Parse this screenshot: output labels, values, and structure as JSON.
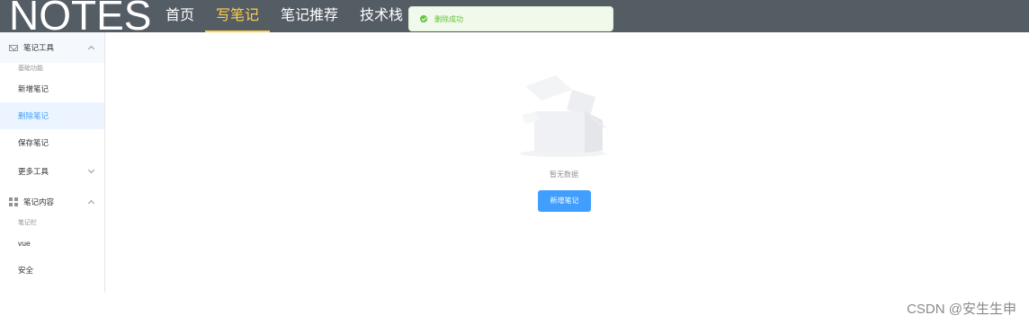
{
  "header": {
    "logo": "NOTES",
    "nav": [
      "首页",
      "写笔记",
      "笔记推荐",
      "技术栈"
    ]
  },
  "toast": {
    "message": "删除成功",
    "icon": "success-check-icon",
    "color": "#67c23a"
  },
  "sidebar": {
    "section1": {
      "title": "笔记工具",
      "icon": "mail-icon",
      "group": "基础功能",
      "items": [
        "新增笔记",
        "删除笔记",
        "保存笔记"
      ],
      "active_item": "删除笔记"
    },
    "more_tools": "更多工具",
    "section2": {
      "title": "笔记内容",
      "icon": "grid-icon",
      "group": "笔记栏",
      "items": [
        "vue",
        "安全"
      ]
    }
  },
  "main": {
    "empty_text": "暂无数据",
    "add_button": "新增笔记",
    "illustration": "empty-box-icon"
  },
  "watermark": "CSDN @安生生申",
  "colors": {
    "header_bg": "#545c64",
    "active_nav": "#ffd04b",
    "primary": "#409eff"
  }
}
